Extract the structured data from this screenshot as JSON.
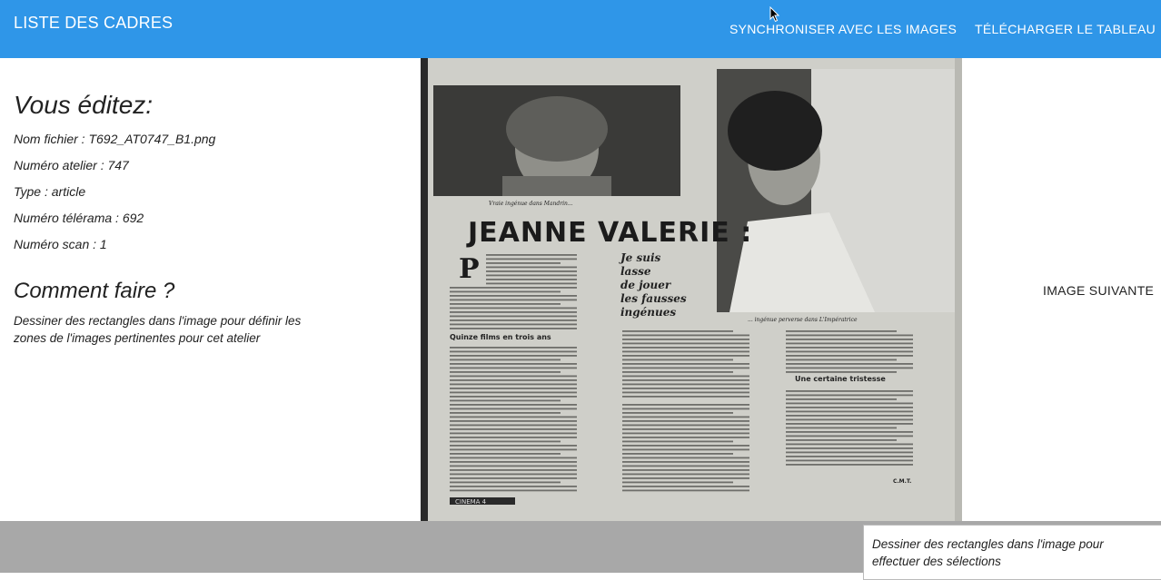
{
  "header": {
    "title": "LISTE DES CADRES",
    "sync_label": "SYNCHRONISER AVEC LES IMAGES",
    "download_label": "TÉLÉCHARGER LE TABLEAU"
  },
  "editing": {
    "heading": "Vous éditez:",
    "file_name": "Nom fichier : T692_AT0747_B1.png",
    "atelier_number": "Numéro atelier : 747",
    "type": "Type : article",
    "telerama_number": "Numéro télérama : 692",
    "scan_number": "Numéro scan : 1"
  },
  "howto": {
    "heading": "Comment faire ?",
    "text": "Dessiner des rectangles dans l'image pour définir les zones de l'images pertinentes pour cet atelier"
  },
  "next_label": "IMAGE SUIVANTE",
  "hint": "Dessiner des rectangles dans l'image pour effectuer des sélections",
  "scan": {
    "headline": "JEANNE VALERIE :",
    "subhead": "Je suis lasse de jouer les fausses ingénues",
    "section1": "Quinze films en trois ans",
    "section2": "Une certaine tristesse",
    "caption_left": "Vraie ingénue dans Mandrin...",
    "caption_right": "... ingénue perverse dans L'Impératrice",
    "footer_tag": "CINEMA 4",
    "signature": "C.M.T."
  },
  "colors": {
    "topbar": "#2f96e8",
    "bottombar": "#a8a8a8"
  }
}
